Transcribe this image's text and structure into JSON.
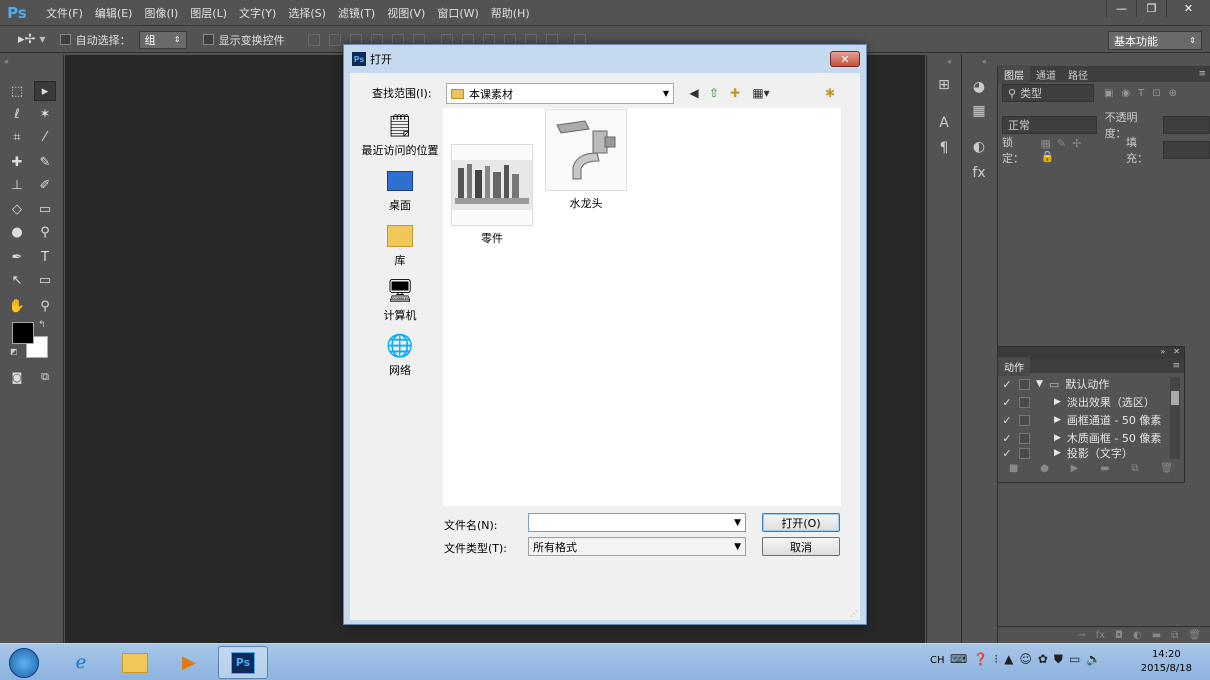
{
  "app": {
    "logo": "Ps"
  },
  "menu": [
    "文件(F)",
    "编辑(E)",
    "图像(I)",
    "图层(L)",
    "文字(Y)",
    "选择(S)",
    "滤镜(T)",
    "视图(V)",
    "窗口(W)",
    "帮助(H)"
  ],
  "window_controls": {
    "minimize": "—",
    "restore": "❐",
    "close": "✕"
  },
  "options_bar": {
    "auto_select_label": "自动选择：",
    "auto_select_value": "组",
    "show_transform_label": "显示变换控件",
    "workspace": "基本功能"
  },
  "layers_panel": {
    "tabs": [
      "图层",
      "通道",
      "路径"
    ],
    "filter_kind": "类型",
    "blend_mode": "正常",
    "opacity_label": "不透明度：",
    "lock_label": "锁定：",
    "fill_label": "填充："
  },
  "actions_panel": {
    "tab": "动作",
    "rows": [
      {
        "label": "默认动作",
        "level": 0,
        "expanded": true,
        "folder": true
      },
      {
        "label": "淡出效果（选区）",
        "level": 1
      },
      {
        "label": "画框通道 - 50 像素",
        "level": 1
      },
      {
        "label": "木质画框 - 50 像素",
        "level": 1
      },
      {
        "label": "投影（文字）",
        "level": 1
      }
    ]
  },
  "dialog": {
    "title": "打开",
    "look_in_label": "查找范围(I):",
    "look_in_value": "本课素材",
    "places": [
      {
        "label": "最近访问的位置",
        "icon": "recent-places-icon"
      },
      {
        "label": "桌面",
        "icon": "desktop-icon"
      },
      {
        "label": "库",
        "icon": "libraries-icon"
      },
      {
        "label": "计算机",
        "icon": "computer-icon"
      },
      {
        "label": "网络",
        "icon": "network-icon"
      }
    ],
    "files": [
      {
        "name": "零件"
      },
      {
        "name": "水龙头"
      }
    ],
    "filename_label": "文件名(N):",
    "filename_value": "",
    "filetype_label": "文件类型(T):",
    "filetype_value": "所有格式",
    "open_button": "打开(O)",
    "cancel_button": "取消"
  },
  "taskbar": {
    "lang": "CH",
    "time": "14:20",
    "date": "2015/8/18",
    "ps_label": "Ps"
  }
}
